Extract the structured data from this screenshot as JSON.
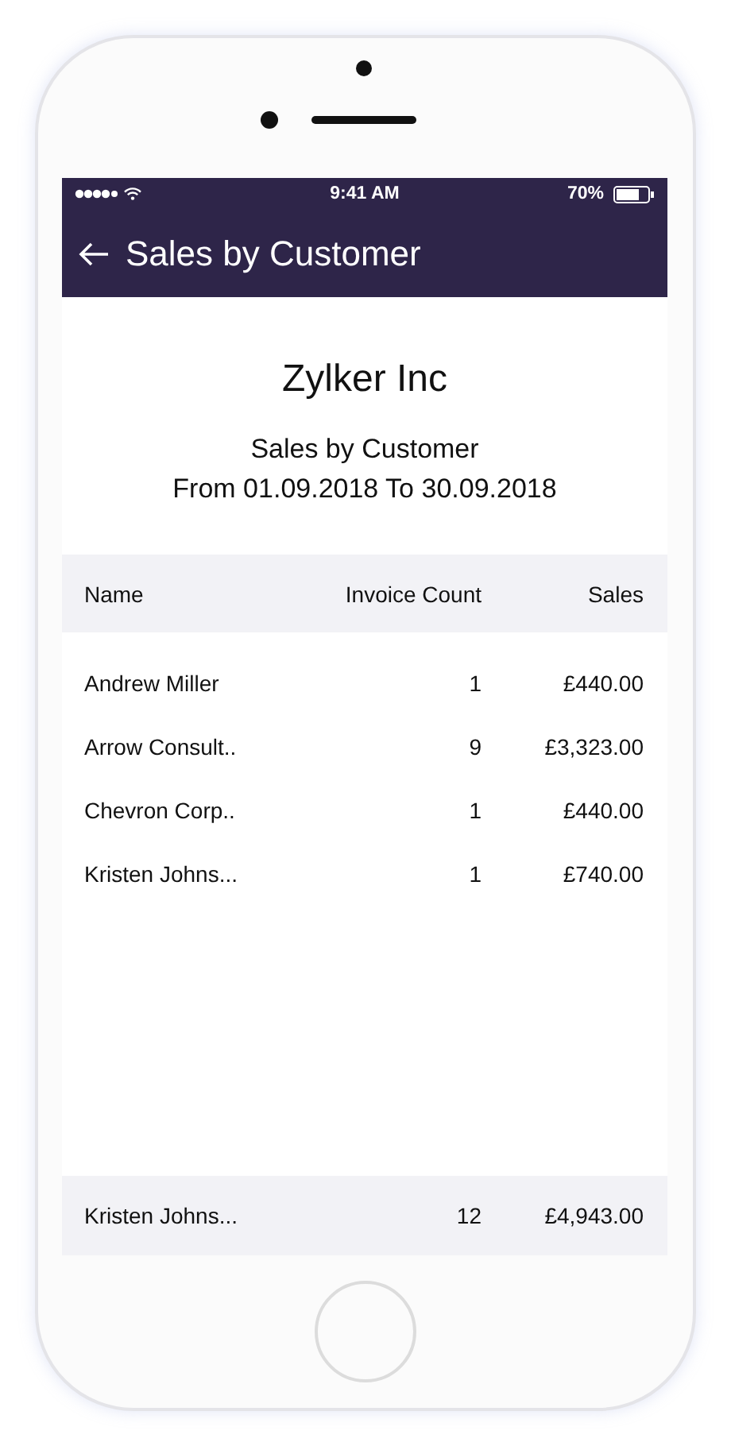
{
  "status_bar": {
    "time": "9:41 AM",
    "battery": "70%"
  },
  "header": {
    "title": "Sales by Customer"
  },
  "report": {
    "company": "Zylker Inc",
    "title": "Sales by Customer",
    "period": "From 01.09.2018 To 30.09.2018"
  },
  "table": {
    "columns": [
      "Name",
      "Invoice Count",
      "Sales"
    ],
    "rows": [
      {
        "name": "Andrew Miller",
        "invoice_count": "1",
        "sales": "£440.00"
      },
      {
        "name": "Arrow Consult..",
        "invoice_count": "9",
        "sales": "£3,323.00"
      },
      {
        "name": "Chevron Corp..",
        "invoice_count": "1",
        "sales": "£440.00"
      },
      {
        "name": "Kristen Johns...",
        "invoice_count": "1",
        "sales": "£740.00"
      }
    ],
    "footer": {
      "name": "Kristen Johns...",
      "invoice_count": "12",
      "sales": "£4,943.00"
    }
  }
}
